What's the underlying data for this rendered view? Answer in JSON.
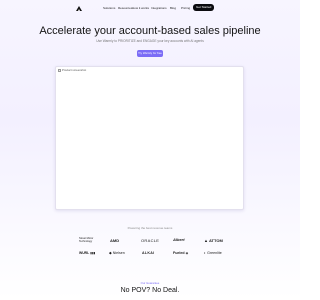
{
  "nav": {
    "items": [
      {
        "label": "Solutions"
      },
      {
        "label": "Resources"
      },
      {
        "label": "How it works"
      },
      {
        "label": "Integrations"
      },
      {
        "label": "Blog"
      },
      {
        "label": "Pricing"
      }
    ],
    "cta_label": "Get Started",
    "logo_icon": "logo-icon"
  },
  "hero": {
    "title": "Accelerate your account-based sales pipeline",
    "subtitle": "Use Warmly to PRIORITIZE and ENGAGE your key accounts with AI agents",
    "cta_label": "Try Warmly for free"
  },
  "media": {
    "alt_text": "Product screenshot"
  },
  "logos": {
    "heading": "Powering the best revenue teams",
    "row1": [
      {
        "name": "Street Motor Technology"
      },
      {
        "name": "AMD"
      },
      {
        "name": "ORACLE"
      },
      {
        "name": "Albert"
      },
      {
        "name": "ATTOM"
      }
    ],
    "row2": [
      {
        "name": "WURL"
      },
      {
        "name": "Nielsen"
      },
      {
        "name": "ALKAI"
      },
      {
        "name": "Fueled"
      },
      {
        "name": "Greenlite"
      }
    ]
  },
  "bottom": {
    "eyebrow": "Our Guarantee",
    "title": "No POV? No Deal."
  },
  "colors": {
    "accent": "#7b6cf6",
    "dark": "#0b0b0f"
  }
}
